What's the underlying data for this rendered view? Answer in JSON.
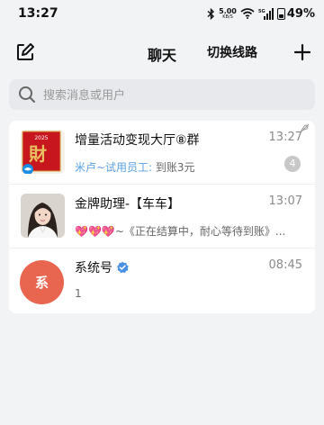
{
  "status_bar": {
    "time": "13:27",
    "net_speed_value": "5.00",
    "net_speed_unit": "KB/S",
    "network_type": "5G",
    "battery": "49%",
    "battery_level": 0.49
  },
  "header": {
    "title": "聊天",
    "switch_label": "切换线路"
  },
  "search": {
    "placeholder": "搜索消息或用户"
  },
  "chats": [
    {
      "name": "增量活动变现大厅⑧群",
      "time": "13:27",
      "sender": "米卢~试用员工:",
      "message": " 到账3元",
      "unread": "4",
      "avatar_year": "2025",
      "muted": true
    },
    {
      "name": "金牌助理-【车车】",
      "time": "13:07",
      "emoji": "💖💖💖",
      "message": "~《正在结算中，耐心等待到账》..."
    },
    {
      "name": "系统号",
      "time": "08:45",
      "message": "1",
      "avatar_text": "系",
      "verified": true
    }
  ],
  "colors": {
    "accent_blue": "#4a90e2",
    "sender_blue": "#5aa0e6",
    "avatar_red": "#e8654f",
    "badge_gray": "#c8c8c8"
  }
}
